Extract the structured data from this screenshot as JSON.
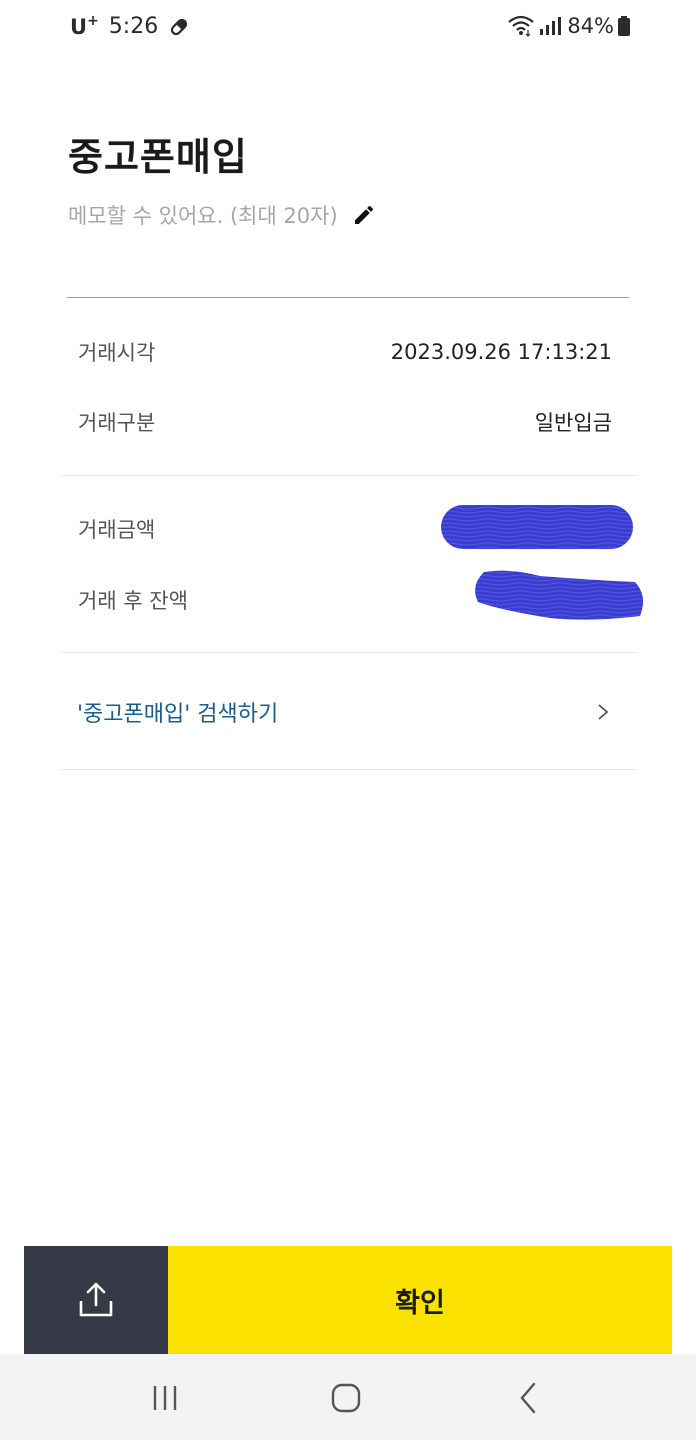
{
  "status_bar": {
    "carrier": "U",
    "carrier_sup": "+",
    "time": "5:26",
    "battery": "84%"
  },
  "header": {
    "title": "중고폰매입",
    "memo_placeholder": "메모할 수 있어요. (최대 20자)"
  },
  "details": {
    "time_label": "거래시각",
    "time_value": "2023.09.26 17:13:21",
    "type_label": "거래구분",
    "type_value": "일반입금",
    "amount_label": "거래금액",
    "balance_label": "거래 후 잔액"
  },
  "search_link": "'중고폰매입' 검색하기",
  "actions": {
    "confirm_label": "확인"
  },
  "colors": {
    "accent_yellow": "#fbe100",
    "share_bg": "#353a46",
    "link_blue": "#1d5c8a",
    "redaction_blue": "#3a3ccf"
  }
}
